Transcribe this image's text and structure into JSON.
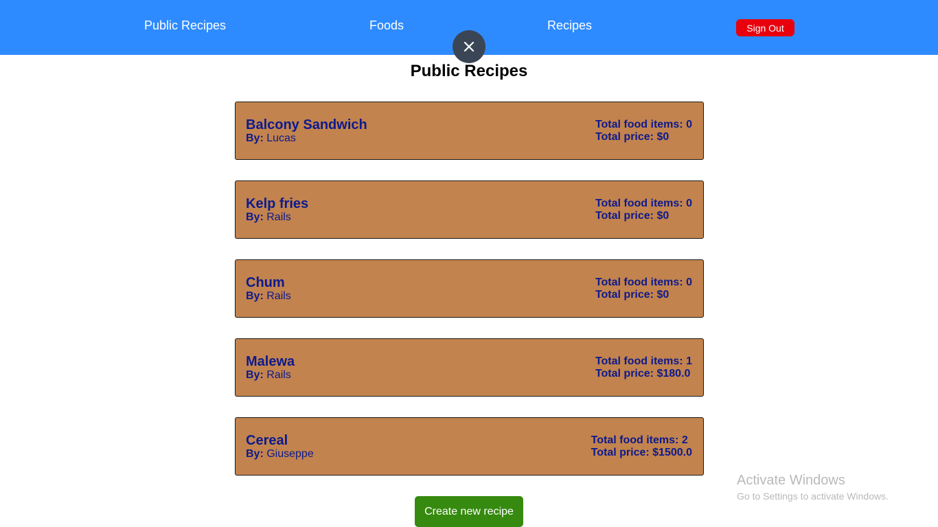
{
  "nav": {
    "public_recipes": "Public Recipes",
    "foods": "Foods",
    "recipes": "Recipes",
    "sign_out": "Sign Out"
  },
  "close_icon": "close-icon",
  "page_title": "Public Recipes",
  "by_label": "By:",
  "total_food_items_label": "Total food items:",
  "total_price_label": "Total price:",
  "recipes": [
    {
      "name": "Balcony Sandwich",
      "author": "Lucas",
      "total_food_items": "0",
      "total_price": "$0"
    },
    {
      "name": "Kelp fries",
      "author": "Rails",
      "total_food_items": "0",
      "total_price": "$0"
    },
    {
      "name": "Chum",
      "author": "Rails",
      "total_food_items": "0",
      "total_price": "$0"
    },
    {
      "name": "Malewa",
      "author": "Rails",
      "total_food_items": "1",
      "total_price": "$180.0"
    },
    {
      "name": "Cereal",
      "author": "Giuseppe",
      "total_food_items": "2",
      "total_price": "$1500.0"
    }
  ],
  "create_button": "Create new recipe",
  "watermark": {
    "title": "Activate Windows",
    "subtitle": "Go to Settings to activate Windows."
  },
  "colors": {
    "navbar": "#2e8bff",
    "sign_out": "#e8000d",
    "card": "#c2834e",
    "card_text": "#0d1a8c",
    "create_button": "#368a0f"
  }
}
